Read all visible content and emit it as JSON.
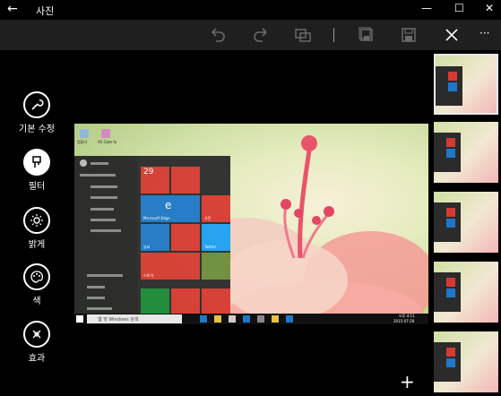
{
  "window": {
    "title": "사진"
  },
  "sidebar": {
    "items": [
      {
        "label": "기본 수정"
      },
      {
        "label": "필터"
      },
      {
        "label": "밝게"
      },
      {
        "label": "색"
      },
      {
        "label": "효과"
      }
    ]
  },
  "photo": {
    "desktop_icons": [
      "컴퓨터",
      "XS Gate fo"
    ],
    "start_date": "29",
    "search_placeholder": "웹 및 Windows 검색",
    "tiles": [
      "Microsoft Edge",
      "사진",
      "날씨",
      "Twitter",
      "스토어"
    ],
    "clock": "오후 4:11",
    "clock_date": "2015-07-28"
  },
  "colors": {
    "accent": "#0078d7",
    "tile_red": "#d63b32",
    "tile_blue": "#1e78c8",
    "tile_green": "#1b8a3a"
  }
}
